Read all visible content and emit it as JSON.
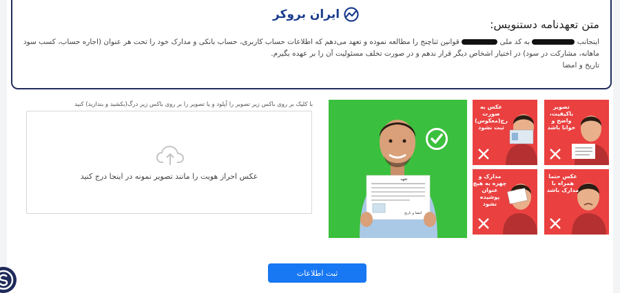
{
  "brand": {
    "name": "ایران بروکر",
    "color": "#1a3a8c"
  },
  "commitment": {
    "title": "متن تعهدنامه دستنویس:",
    "line1_start": "اینجانب",
    "line1_mid": "به کد ملی",
    "line1_rest": "قوانین ثناچنج را مطالعه نموده و تعهد می‌دهم که اطلاعات حساب کاربری، حساب بانکی و مدارک خود را تحت هر عنوان (اجاره حساب، کسب سود ماهانه، مشارکت در سود) در اختیار اشخاص دیگر قرار ندهم و در صورت تخلف مسئولیت آن را بر عهده بگیرم.",
    "line2": "تاریخ و امضا"
  },
  "upload": {
    "hint": "با کلیک بر روی باکس زیر تصویر را آپلود و یا تصویر را بر روی باکس زیر درگ(بکشید و بندازید) کنید",
    "box_text": "عکس احراز هویت را مانند تصویر نمونه در اینجا درج کنید",
    "icon": "cloud-upload-icon"
  },
  "sample": {
    "background": "#3bbf3e",
    "paper_heading": "تعهد",
    "paper_signature": "امضا و تاریخ"
  },
  "tiles": [
    {
      "caption": "تصویر باکیفیت، واضح و خوانا باشد",
      "icon": "close-icon"
    },
    {
      "caption": "عکس به صورت رچ(معکوس) ثبت نشود",
      "icon": "close-icon"
    },
    {
      "caption": "عکس حتما همراه با مدارک باشد",
      "icon": "close-icon"
    },
    {
      "caption": "مدارک و چهره به هیچ عنوان پوشیده نشود",
      "icon": "close-icon"
    }
  ],
  "submit": {
    "label": "ثبت اطلاعات",
    "color": "#1877f2"
  }
}
